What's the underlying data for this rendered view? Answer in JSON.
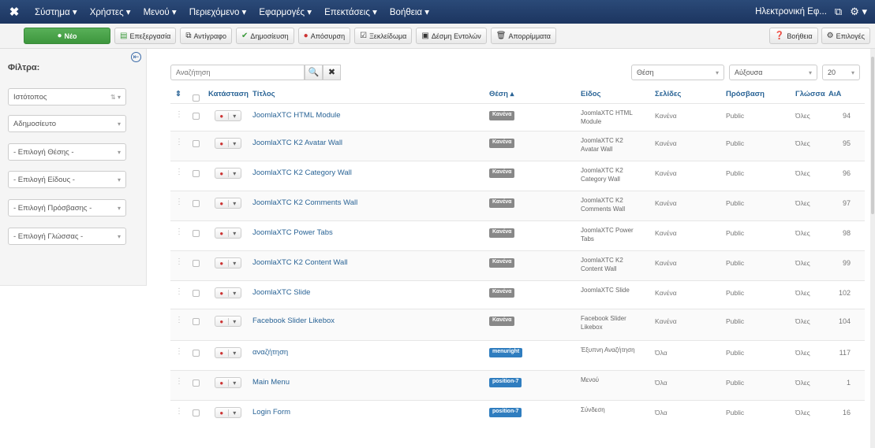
{
  "nav": {
    "logo": "✖",
    "menu": [
      "Σύστημα ▾",
      "Χρήστες ▾",
      "Μενού ▾",
      "Περιεχόμενο ▾",
      "Εφαρμογές ▾",
      "Επεκτάσεις ▾",
      "Βοήθεια ▾"
    ],
    "user": "Ηλεκτρονική Εφ...",
    "user_icon": "⧉",
    "gear": "⚙ ▾"
  },
  "toolbar": {
    "new": "Νέο",
    "edit": "Επεξεργασία",
    "duplicate": "Αντίγραφο",
    "publish": "Δημοσίευση",
    "unpublish": "Απόσυρση",
    "checkin": "Ξεκλείδωμα",
    "batch": "Δέσμη Εντολών",
    "trash": "Απορρίμματα",
    "help": "Βοήθεια",
    "options": "Επιλογές"
  },
  "sidebar": {
    "title": "Φίλτρα:",
    "filters": [
      "Ιστότοπος",
      "Αδημοσίευτο",
      "- Επιλογή Θέσης -",
      "- Επιλογή Είδους -",
      "- Επιλογή Πρόσβασης -",
      "- Επιλογή Γλώσσας -"
    ],
    "filter_arrows": [
      "⇅ ▾",
      "▾",
      "▾",
      "▾",
      "▾",
      "▾"
    ]
  },
  "search": {
    "placeholder": "Αναζήτηση",
    "search_icon": "🔍",
    "clear_icon": "✖"
  },
  "selects": {
    "sort": "Θέση",
    "order": "Αύξουσα",
    "limit": "20"
  },
  "table": {
    "headers": {
      "order": "⇕",
      "status": "Κατάσταση",
      "title": "Τίτλος",
      "position": "Θέση ▴",
      "type": "Είδος",
      "pages": "Σελίδες",
      "access": "Πρόσβαση",
      "language": "Γλώσσα",
      "id": "ΑιΑ"
    },
    "rows": [
      {
        "title": "JoomlaXTC HTML Module",
        "position": "Κανένα",
        "pos_color": "#888888",
        "type": "JoomlaXTC HTML Module",
        "pages": "Κανένα",
        "access": "Public",
        "language": "Όλες",
        "id": "94"
      },
      {
        "title": "JoomlaXTC K2 Avatar Wall",
        "position": "Κανένα",
        "pos_color": "#888888",
        "type": "JoomlaXTC K2 Avatar Wall",
        "pages": "Κανένα",
        "access": "Public",
        "language": "Όλες",
        "id": "95"
      },
      {
        "title": "JoomlaXTC K2 Category Wall",
        "position": "Κανένα",
        "pos_color": "#888888",
        "type": "JoomlaXTC K2 Category Wall",
        "pages": "Κανένα",
        "access": "Public",
        "language": "Όλες",
        "id": "96"
      },
      {
        "title": "JoomlaXTC K2 Comments Wall",
        "position": "Κανένα",
        "pos_color": "#888888",
        "type": "JoomlaXTC K2 Comments Wall",
        "pages": "Κανένα",
        "access": "Public",
        "language": "Όλες",
        "id": "97"
      },
      {
        "title": "JoomlaXTC Power Tabs",
        "position": "Κανένα",
        "pos_color": "#888888",
        "type": "JoomlaXTC Power Tabs",
        "pages": "Κανένα",
        "access": "Public",
        "language": "Όλες",
        "id": "98"
      },
      {
        "title": "JoomlaXTC K2 Content Wall",
        "position": "Κανένα",
        "pos_color": "#888888",
        "type": "JoomlaXTC K2 Content Wall",
        "pages": "Κανένα",
        "access": "Public",
        "language": "Όλες",
        "id": "99"
      },
      {
        "title": "JoomlaXTC Slide",
        "position": "Κανένα",
        "pos_color": "#888888",
        "type": "JoomlaXTC Slide",
        "pages": "Κανένα",
        "access": "Public",
        "language": "Όλες",
        "id": "102"
      },
      {
        "title": "Facebook Slider Likebox",
        "position": "Κανένα",
        "pos_color": "#888888",
        "type": "Facebook Slider Likebox",
        "pages": "Κανένα",
        "access": "Public",
        "language": "Όλες",
        "id": "104"
      },
      {
        "title": "αναζήτηση",
        "position": "menuright",
        "pos_color": "#2f7dbf",
        "type": "Έξυπνη Αναζήτηση",
        "pages": "Όλα",
        "access": "Public",
        "language": "Όλες",
        "id": "117"
      },
      {
        "title": "Main Menu",
        "position": "position-7",
        "pos_color": "#2f7dbf",
        "type": "Μενού",
        "pages": "Όλα",
        "access": "Public",
        "language": "Όλες",
        "id": "1"
      },
      {
        "title": "Login Form",
        "position": "position-7",
        "pos_color": "#2f7dbf",
        "type": "Σύνδεση",
        "pages": "Όλα",
        "access": "Public",
        "language": "Όλες",
        "id": "16"
      }
    ]
  }
}
